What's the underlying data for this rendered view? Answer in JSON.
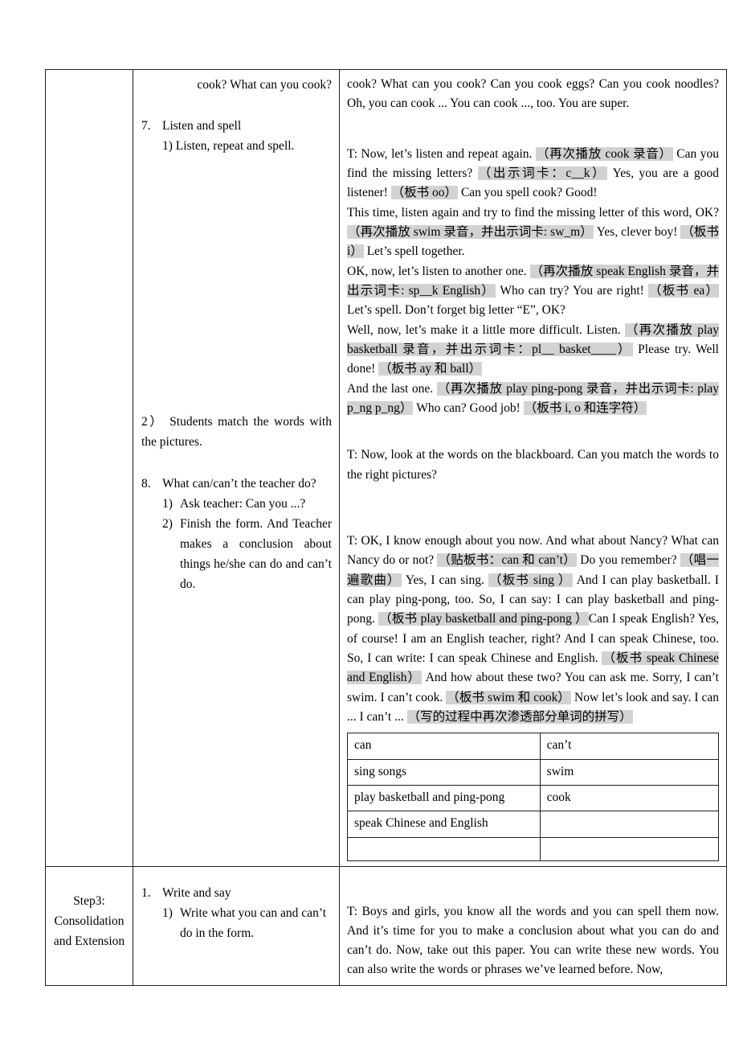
{
  "document": {
    "kind": "lesson-plan-table",
    "highlight_color": "#d2d2d2",
    "border_color": "#231f20"
  },
  "rows": [
    {
      "step": "",
      "procedure": {
        "continued_line": "cook? What can you cook?",
        "items": [
          {
            "num": "7.",
            "title": "Listen and spell",
            "subs": [
              {
                "num": "1)",
                "text": "Listen, repeat and spell."
              }
            ]
          },
          {
            "num": "",
            "title": "",
            "subs": [
              {
                "num": "2）",
                "text": "Students match the words with the pictures."
              }
            ]
          },
          {
            "num": "8.",
            "title": "What can/can’t the teacher do?",
            "subs": [
              {
                "num": "1)",
                "text": "Ask teacher: Can you ...?"
              },
              {
                "num": "2)",
                "text": "Finish the form. And Teacher makes a conclusion about things he/she can do and can’t do."
              }
            ]
          }
        ]
      },
      "script": {
        "continued_para": "cook? What can you cook? Can you cook eggs? Can you cook noodles? Oh, you can cook ... You can cook ..., too. You are super.",
        "blocks": [
          {
            "id": "listen-and-spell-script",
            "segments": [
              {
                "type": "plain",
                "text": "T: Now, let’s listen and repeat again. "
              },
              {
                "type": "highlight",
                "text": "（再次播放 cook 录音）"
              },
              {
                "type": "plain",
                "text": " Can you find the missing letters? "
              },
              {
                "type": "highlight",
                "text": "（出示词卡：c__k）"
              },
              {
                "type": "plain",
                "text": " Yes, you are a good listener! "
              },
              {
                "type": "highlight",
                "text": "（板书 oo）"
              },
              {
                "type": "plain",
                "text": " Can you spell cook? Good!"
              }
            ]
          },
          {
            "id": "swim-spelling-script",
            "segments": [
              {
                "type": "plain",
                "text": "This time, listen again and try to find the missing letter of this word, OK? "
              },
              {
                "type": "highlight",
                "text": "（再次播放 swim 录音，并出示词卡: sw_m）"
              },
              {
                "type": "plain",
                "text": " Yes, clever boy! "
              },
              {
                "type": "highlight",
                "text": "（板书 i）"
              },
              {
                "type": "plain",
                "text": " Let’s spell together."
              }
            ]
          },
          {
            "id": "speak-english-spelling-script",
            "segments": [
              {
                "type": "plain",
                "text": "OK, now, let’s listen to another one. "
              },
              {
                "type": "highlight",
                "text": "（再次播放 speak English 录音，并出示词卡: sp__k English）"
              },
              {
                "type": "plain",
                "text": " Who can try? You are right! "
              },
              {
                "type": "highlight",
                "text": "（板书 ea）"
              },
              {
                "type": "plain",
                "text": " Let’s spell. Don’t forget big letter “E”, OK?"
              }
            ]
          },
          {
            "id": "play-basketball-spelling-script",
            "segments": [
              {
                "type": "plain",
                "text": "Well, now, let’s make it a little more difficult. Listen. "
              },
              {
                "type": "highlight",
                "text": "（再次播放 play basketball 录音，并出示词卡：pl__ basket____）"
              },
              {
                "type": "plain",
                "text": " Please try. Well done! "
              },
              {
                "type": "highlight",
                "text": "（板书 ay 和 ball）"
              }
            ]
          },
          {
            "id": "play-ping-pong-spelling-script",
            "segments": [
              {
                "type": "plain",
                "text": "And the last one. "
              },
              {
                "type": "highlight",
                "text": "（再次播放 play ping-pong 录音，并出示词卡: play p_ng p_ng）"
              },
              {
                "type": "plain",
                "text": " Who can? Good job! "
              },
              {
                "type": "highlight",
                "text": "（板书 i, o 和连字符）"
              }
            ]
          },
          {
            "id": "match-words-script",
            "segments": [
              {
                "type": "plain",
                "text": "T: Now, look at the words on the blackboard. Can you match the words to the right pictures?"
              }
            ]
          },
          {
            "id": "teacher-can-cant-script",
            "segments": [
              {
                "type": "plain",
                "text": "T: OK, I know enough about you now. And what about Nancy? What can Nancy do or not? "
              },
              {
                "type": "highlight",
                "text": "（贴板书：can 和 can’t）"
              },
              {
                "type": "plain",
                "text": " Do you remember? "
              },
              {
                "type": "highlight",
                "text": "（唱一遍歌曲）"
              },
              {
                "type": "plain",
                "text": " Yes, I can sing. "
              },
              {
                "type": "highlight",
                "text": "（板书 sing ）"
              },
              {
                "type": "plain",
                "text": " And I can play basketball. I can play ping-pong, too. So, I can say: I can play basketball and ping-pong. "
              },
              {
                "type": "highlight",
                "text": "（板书 play basketball and ping-pong ）"
              },
              {
                "type": "plain",
                "text": "Can I speak English? Yes, of course! I am an English teacher, right? And I can speak Chinese, too. So, I can write: I can speak Chinese and English. "
              },
              {
                "type": "highlight",
                "text": "（板书 speak Chinese and English）"
              },
              {
                "type": "plain",
                "text": " And how about these two? You can ask me. Sorry, I can’t swim. I can’t cook. "
              },
              {
                "type": "highlight",
                "text": "（板书 swim 和 cook）"
              },
              {
                "type": "plain",
                "text": " Now let’s look and say. I can ... I can’t ... "
              },
              {
                "type": "highlight",
                "text": "（写的过程中再次渗透部分单词的拼写）"
              }
            ]
          }
        ],
        "form_table": {
          "headers": [
            "can",
            "can’t"
          ],
          "rows": [
            [
              "sing songs",
              "swim"
            ],
            [
              "play basketball and ping-pong",
              "cook"
            ],
            [
              "speak Chinese and English",
              ""
            ],
            [
              "",
              ""
            ]
          ]
        }
      }
    },
    {
      "step": "Step3: Consolidation and Extension",
      "procedure": {
        "continued_line": "",
        "items": [
          {
            "num": "1.",
            "title": "Write and say",
            "subs": [
              {
                "num": "1)",
                "text": "Write what you can and can’t do in the form."
              }
            ]
          }
        ]
      },
      "script": {
        "continued_para": "",
        "blocks": [
          {
            "id": "write-and-say-script",
            "segments": [
              {
                "type": "plain",
                "text": "T: Boys and girls, you know all the words and you can spell them now. And it’s time for you to make a conclusion about what you can do and can’t do. Now, take out this paper. You can write these new words. You can also write the words or phrases we’ve learned before. Now,"
              }
            ]
          }
        ]
      }
    }
  ]
}
